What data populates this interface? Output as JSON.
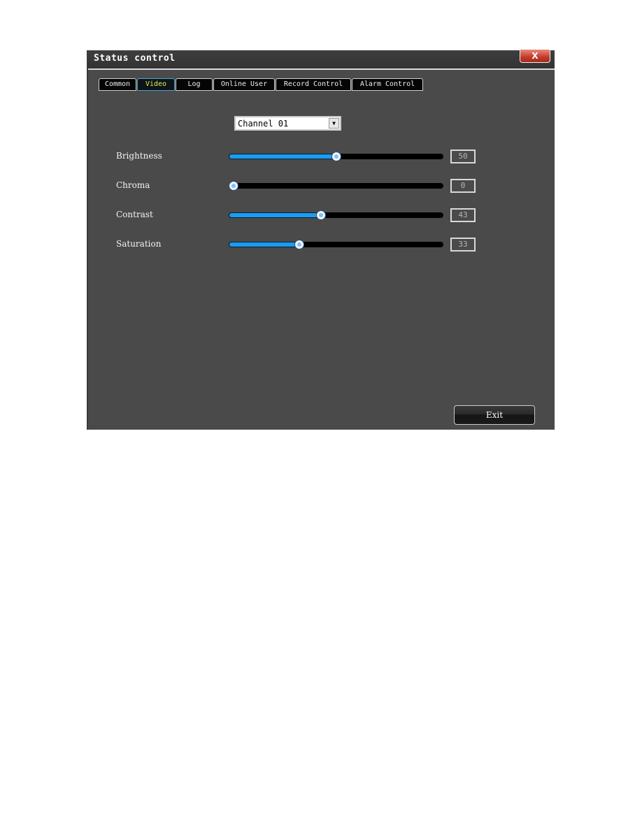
{
  "window": {
    "title": "Status control",
    "close_label": "X"
  },
  "tabs": [
    {
      "label": "Common",
      "active": false
    },
    {
      "label": "Video",
      "active": true
    },
    {
      "label": "Log",
      "active": false
    },
    {
      "label": "Online User",
      "active": false
    },
    {
      "label": "Record Control",
      "active": false
    },
    {
      "label": "Alarm Control",
      "active": false
    }
  ],
  "channel": {
    "selected": "Channel 01",
    "arrow": "▼"
  },
  "sliders": [
    {
      "label": "Brightness",
      "value": "50",
      "percent": 50
    },
    {
      "label": "Chroma",
      "value": "0",
      "percent": 0
    },
    {
      "label": "Contrast",
      "value": "43",
      "percent": 43
    },
    {
      "label": "Saturation",
      "value": "33",
      "percent": 33
    }
  ],
  "exit_label": "Exit",
  "colors": {
    "accent": "#1a9cf0",
    "active_tab_text": "#e6f05a",
    "close": "#c43a2a"
  }
}
